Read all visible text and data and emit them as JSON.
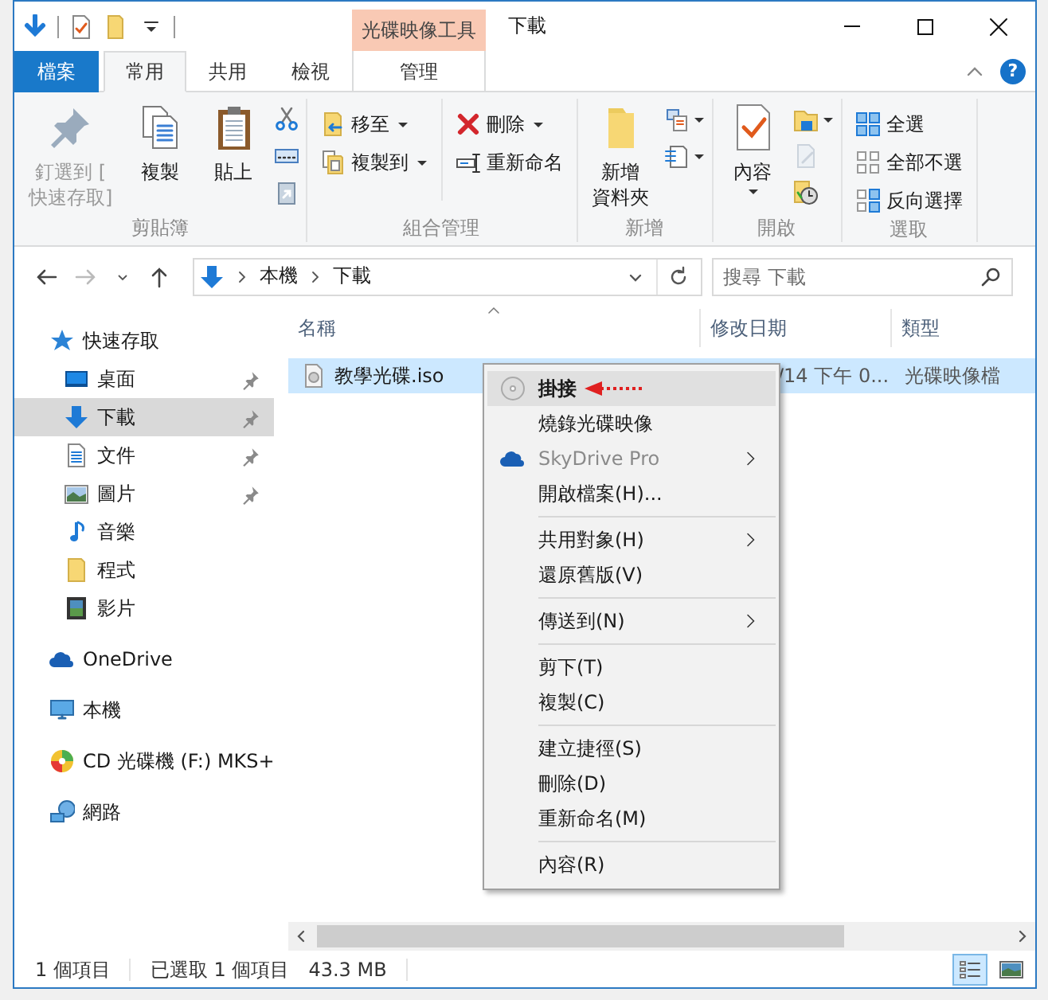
{
  "title_bar": {
    "tool_group": "光碟映像工具",
    "title": "下載"
  },
  "ribbon_tabs": [
    {
      "label": "檔案",
      "kind": "file",
      "selected": false
    },
    {
      "label": "常用",
      "kind": "normal",
      "selected": true
    },
    {
      "label": "共用",
      "kind": "normal",
      "selected": false
    },
    {
      "label": "檢視",
      "kind": "normal",
      "selected": false
    },
    {
      "label": "管理",
      "kind": "contextual",
      "selected": false
    }
  ],
  "help": "?",
  "ribbon_groups": [
    {
      "label": "剪貼簿",
      "columns": [
        [
          {
            "kind": "large",
            "lines": [
              "釘選到 [",
              "快速存取]"
            ],
            "disabled": true,
            "dropdown": false
          }
        ],
        [
          {
            "kind": "large",
            "lines": [
              "複製"
            ],
            "disabled": false,
            "dropdown": false
          }
        ],
        [
          {
            "kind": "large",
            "lines": [
              "貼上"
            ],
            "disabled": false,
            "dropdown": false
          }
        ],
        [
          {
            "kind": "icon",
            "disabled": false,
            "dropdown": false
          },
          {
            "kind": "icon",
            "disabled": false,
            "dropdown": false
          },
          {
            "kind": "icon",
            "disabled": false,
            "dropdown": false
          }
        ]
      ]
    },
    {
      "label": "組合管理",
      "columns": [
        [
          {
            "kind": "small",
            "label": "移至",
            "disabled": false,
            "dropdown": true
          },
          {
            "kind": "small",
            "label": "複製到",
            "disabled": false,
            "dropdown": true
          }
        ],
        [
          {
            "kind": "small",
            "label": "刪除",
            "disabled": false,
            "dropdown": true
          },
          {
            "kind": "small",
            "label": "重新命名",
            "disabled": false,
            "dropdown": false
          }
        ]
      ]
    },
    {
      "label": "新增",
      "columns": [
        [
          {
            "kind": "large",
            "lines": [
              "新增",
              "資料夾"
            ],
            "disabled": false,
            "dropdown": false
          }
        ],
        [
          {
            "kind": "icon",
            "disabled": false,
            "dropdown": true
          },
          {
            "kind": "icon",
            "disabled": false,
            "dropdown": true
          }
        ]
      ]
    },
    {
      "label": "開啟",
      "columns": [
        [
          {
            "kind": "large",
            "lines": [
              "內容"
            ],
            "disabled": false,
            "dropdown": true
          }
        ],
        [
          {
            "kind": "icon",
            "disabled": false,
            "dropdown": true
          },
          {
            "kind": "icon",
            "disabled": true,
            "dropdown": false
          },
          {
            "kind": "icon",
            "disabled": false,
            "dropdown": false
          }
        ]
      ]
    },
    {
      "label": "選取",
      "columns": [
        [
          {
            "kind": "small",
            "label": "全選",
            "disabled": false,
            "dropdown": false
          },
          {
            "kind": "small",
            "label": "全部不選",
            "disabled": false,
            "dropdown": false
          },
          {
            "kind": "small",
            "label": "反向選擇",
            "disabled": false,
            "dropdown": false
          }
        ]
      ]
    }
  ],
  "address": {
    "crumbs": [
      "本機",
      "下載"
    ]
  },
  "search": {
    "placeholder": "搜尋 下載"
  },
  "sidebar": {
    "items": [
      {
        "label": "快速存取",
        "selected": false,
        "children": [
          {
            "label": "桌面",
            "pinned": true,
            "selected": false
          },
          {
            "label": "下載",
            "pinned": true,
            "selected": true
          },
          {
            "label": "文件",
            "pinned": true,
            "selected": false
          },
          {
            "label": "圖片",
            "pinned": true,
            "selected": false
          },
          {
            "label": "音樂",
            "pinned": false,
            "selected": false
          },
          {
            "label": "程式",
            "pinned": false,
            "selected": false
          },
          {
            "label": "影片",
            "pinned": false,
            "selected": false
          }
        ]
      },
      {
        "label": "OneDrive",
        "selected": false
      },
      {
        "label": "本機",
        "selected": false
      },
      {
        "label": "CD 光碟機 (F:) MKS+",
        "selected": false
      },
      {
        "label": "網路",
        "selected": false
      }
    ]
  },
  "table": {
    "columns": [
      "名稱",
      "修改日期",
      "類型"
    ],
    "rows": [
      {
        "name": "教學光碟.iso",
        "modified": "/14 下午 0...",
        "type": "光碟映像檔",
        "selected": true
      }
    ]
  },
  "context_menu": {
    "sections": [
      [
        {
          "label": "掛接",
          "kind": "disc",
          "default": true,
          "disabled": false,
          "submenu": false,
          "selected": true
        },
        {
          "label": "燒錄光碟映像",
          "kind": "text",
          "default": false,
          "disabled": false,
          "submenu": false,
          "selected": false
        },
        {
          "label": "SkyDrive Pro",
          "kind": "cloud",
          "default": false,
          "disabled": true,
          "submenu": true,
          "selected": false
        },
        {
          "label": "開啟檔案(H)...",
          "kind": "text",
          "default": false,
          "disabled": false,
          "submenu": false,
          "selected": false
        }
      ],
      [
        {
          "label": "共用對象(H)",
          "kind": "text",
          "default": false,
          "disabled": false,
          "submenu": true,
          "selected": false
        },
        {
          "label": "還原舊版(V)",
          "kind": "text",
          "default": false,
          "disabled": false,
          "submenu": false,
          "selected": false
        }
      ],
      [
        {
          "label": "傳送到(N)",
          "kind": "text",
          "default": false,
          "disabled": false,
          "submenu": true,
          "selected": false
        }
      ],
      [
        {
          "label": "剪下(T)",
          "kind": "text",
          "default": false,
          "disabled": false,
          "submenu": false,
          "selected": false
        },
        {
          "label": "複製(C)",
          "kind": "text",
          "default": false,
          "disabled": false,
          "submenu": false,
          "selected": false
        }
      ],
      [
        {
          "label": "建立捷徑(S)",
          "kind": "text",
          "default": false,
          "disabled": false,
          "submenu": false,
          "selected": false
        },
        {
          "label": "刪除(D)",
          "kind": "text",
          "default": false,
          "disabled": false,
          "submenu": false,
          "selected": false
        },
        {
          "label": "重新命名(M)",
          "kind": "text",
          "default": false,
          "disabled": false,
          "submenu": false,
          "selected": false
        }
      ],
      [
        {
          "label": "內容(R)",
          "kind": "text",
          "default": false,
          "disabled": false,
          "submenu": false,
          "selected": false
        }
      ]
    ]
  },
  "status_bar": {
    "item_count": "1 個項目",
    "selection": "已選取 1 個項目",
    "size": "43.3 MB",
    "views": [
      {
        "selected": true
      },
      {
        "selected": false
      }
    ]
  }
}
